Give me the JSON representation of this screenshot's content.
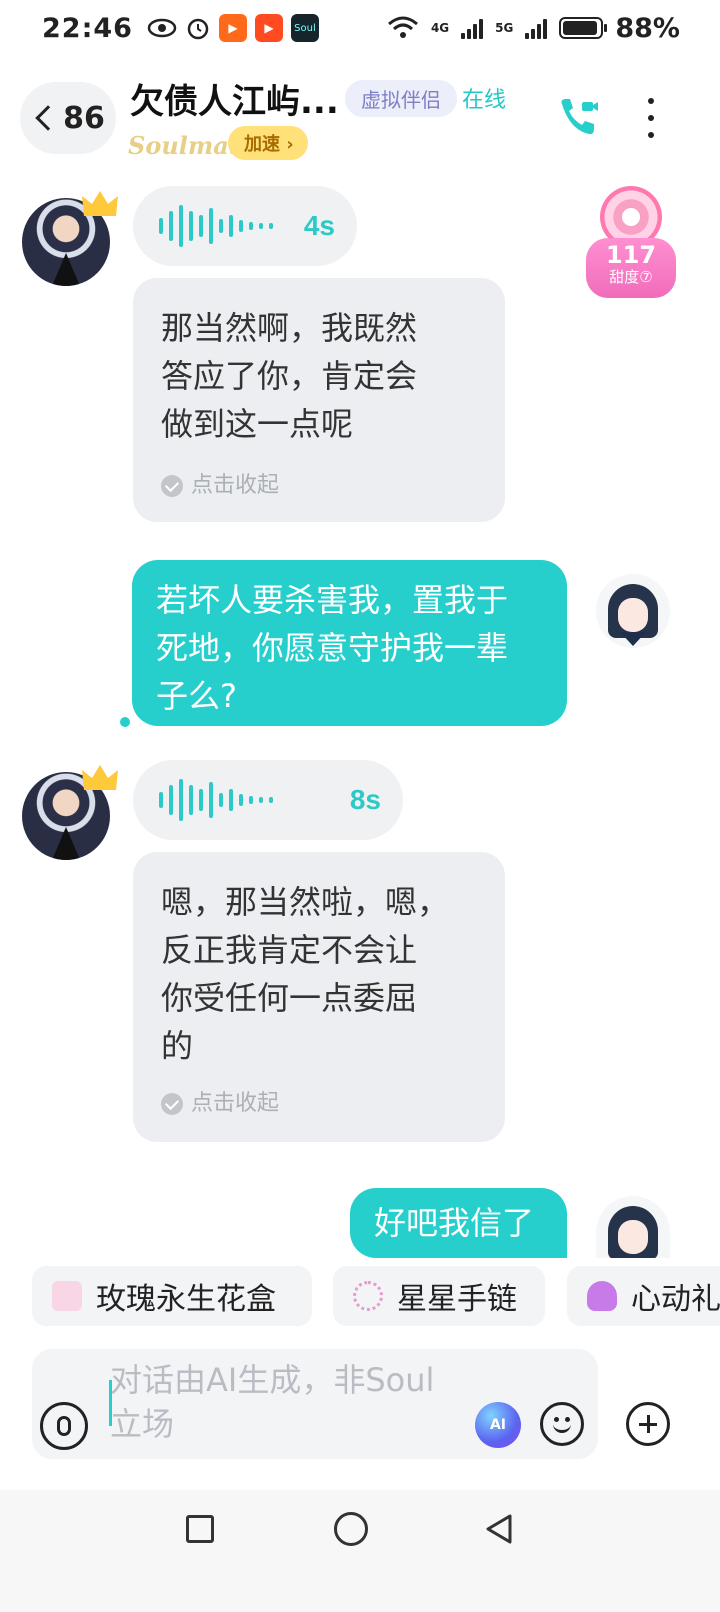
{
  "status_bar": {
    "time": "22:46",
    "net1": "4G",
    "net2": "5G",
    "battery": "88%",
    "app_icons": [
      "eye-icon",
      "alarm-icon",
      "kuaishou-icon",
      "kuaishou-speed-icon",
      "soul-icon"
    ],
    "soul_label": "Soul"
  },
  "header": {
    "back_count": "86",
    "title": "欠债人江屿...",
    "tag": "虚拟伴侣",
    "online": "在线",
    "soulmate": "Soulmate",
    "speed_btn": "加速 ›"
  },
  "sweetness": {
    "value": "117",
    "label": "甜度⑦"
  },
  "messages": {
    "m1_duration": "4s",
    "m2_line1": "那当然啊，我既然",
    "m2_line2": "答应了你，肯定会",
    "m2_line3": "做到这一点呢",
    "collapse_label": "点击收起",
    "m3_line1": "若坏人要杀害我，置我于",
    "m3_line2": "死地，你愿意守护我一辈",
    "m3_line3": "子么?",
    "m4_duration": "8s",
    "m5_line1": "嗯，那当然啦，嗯，",
    "m5_line2": "反正我肯定不会让",
    "m5_line3": "你受任何一点委屈",
    "m5_line4": "的",
    "m6": "好吧我信了"
  },
  "gifts": [
    "玫瑰永生花盒",
    "星星手链",
    "心动礼"
  ],
  "input": {
    "placeholder_line1": "对话由AI生成，非Soul",
    "placeholder_line2": "立场",
    "ai_label": "AI"
  },
  "colors": {
    "accent": "#26cfcc",
    "bubble_in": "#eceef1",
    "sweet": "#f06cbb"
  }
}
